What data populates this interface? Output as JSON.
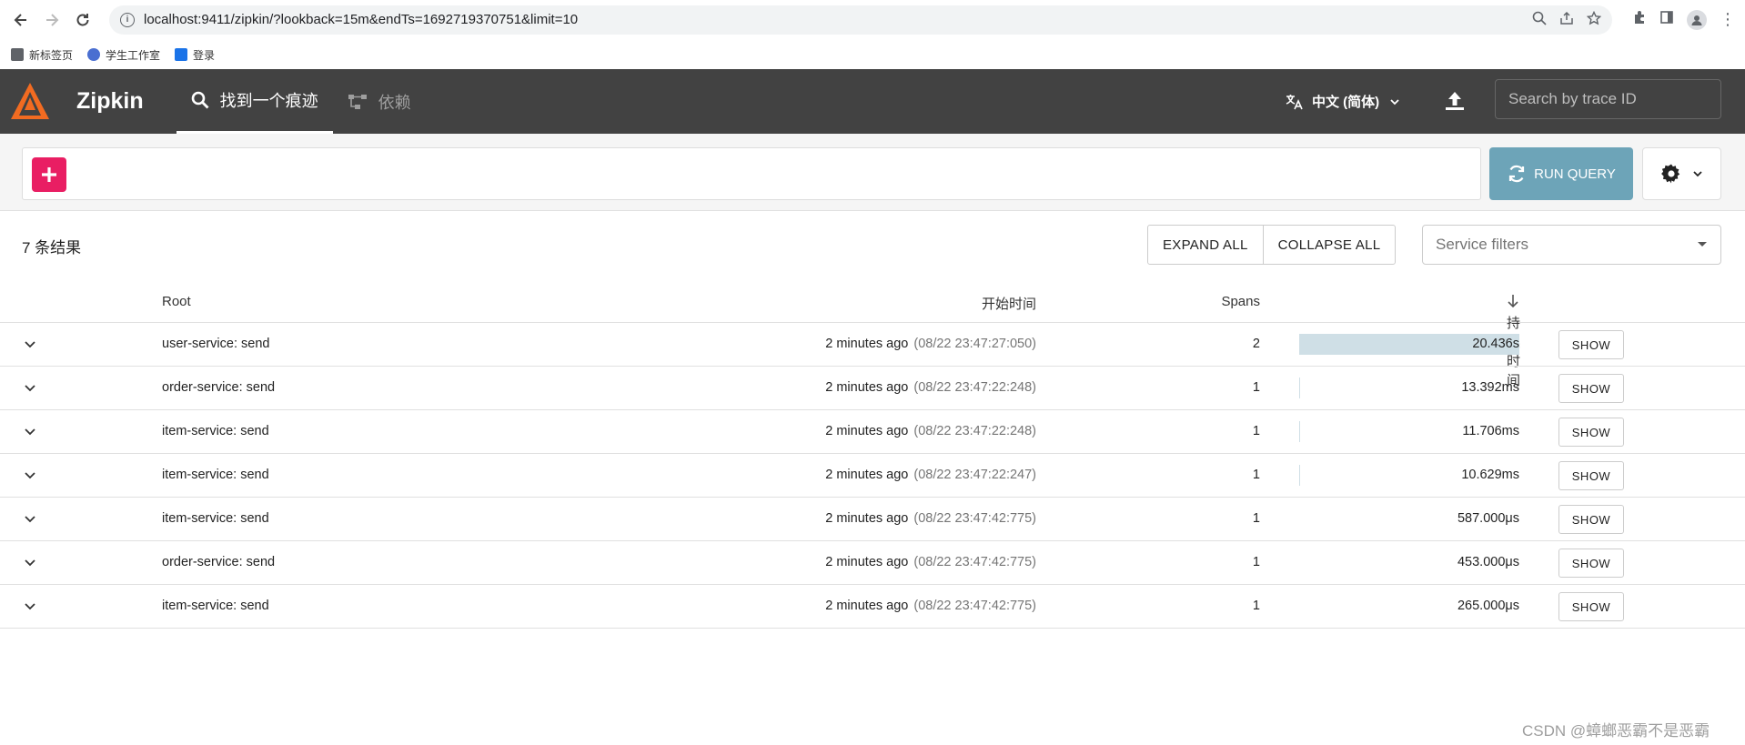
{
  "browser": {
    "url": "localhost:9411/zipkin/?lookback=15m&endTs=1692719370751&limit=10",
    "info_icon": "info-icon",
    "bookmarks": [
      {
        "label": "新标签页",
        "color": "#5f6368"
      },
      {
        "label": "学生工作室",
        "color": "#4a6fd1"
      },
      {
        "label": "登录",
        "color": "#1a73e8"
      }
    ]
  },
  "header": {
    "brand": "Zipkin",
    "tabs": [
      {
        "label": "找到一个痕迹",
        "icon": "search-icon"
      },
      {
        "label": "依赖",
        "icon": "dependency-icon"
      }
    ],
    "language": "中文 (简体)",
    "search_placeholder": "Search by trace ID",
    "colors": {
      "bar": "#424242",
      "logo": "#f26b21"
    }
  },
  "query": {
    "run_label": "RUN QUERY",
    "run_color": "#6da4b8",
    "add_color": "#e91e63"
  },
  "results": {
    "count_label": "7 条结果",
    "expand_all": "EXPAND ALL",
    "collapse_all": "COLLAPSE ALL",
    "service_filter_placeholder": "Service filters",
    "columns": {
      "root": "Root",
      "start": "开始时间",
      "spans": "Spans",
      "duration": "持续时间"
    },
    "show_label": "SHOW",
    "rows": [
      {
        "root": "user-service: send",
        "ago": "2 minutes ago",
        "ts": "(08/22 23:47:27:050)",
        "spans": "2",
        "duration": "20.436s",
        "dur_fraction": 1.0
      },
      {
        "root": "order-service: send",
        "ago": "2 minutes ago",
        "ts": "(08/22 23:47:22:248)",
        "spans": "1",
        "duration": "13.392ms",
        "dur_fraction": 0.0007
      },
      {
        "root": "item-service: send",
        "ago": "2 minutes ago",
        "ts": "(08/22 23:47:22:248)",
        "spans": "1",
        "duration": "11.706ms",
        "dur_fraction": 0.0006
      },
      {
        "root": "item-service: send",
        "ago": "2 minutes ago",
        "ts": "(08/22 23:47:22:247)",
        "spans": "1",
        "duration": "10.629ms",
        "dur_fraction": 0.0005
      },
      {
        "root": "item-service: send",
        "ago": "2 minutes ago",
        "ts": "(08/22 23:47:42:775)",
        "spans": "1",
        "duration": "587.000μs",
        "dur_fraction": 3e-05
      },
      {
        "root": "order-service: send",
        "ago": "2 minutes ago",
        "ts": "(08/22 23:47:42:775)",
        "spans": "1",
        "duration": "453.000μs",
        "dur_fraction": 2e-05
      },
      {
        "root": "item-service: send",
        "ago": "2 minutes ago",
        "ts": "(08/22 23:47:42:775)",
        "spans": "1",
        "duration": "265.000μs",
        "dur_fraction": 1e-05
      }
    ]
  },
  "watermark": "CSDN @蟑螂恶霸不是恶霸"
}
